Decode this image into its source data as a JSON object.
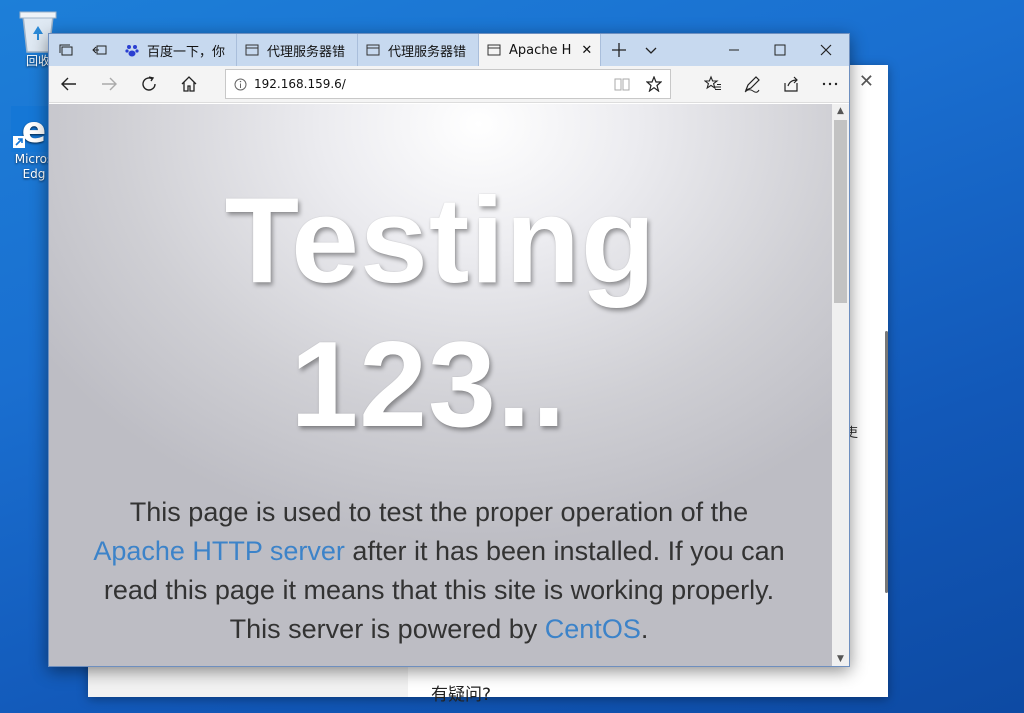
{
  "desktop": {
    "icons": [
      {
        "label": "回收",
        "icon": "recycle-bin-icon"
      },
      {
        "label": "Micros Edg",
        "icon": "edge-icon"
      }
    ]
  },
  "background_window": {
    "text_glyph": "吏",
    "question": "有疑问?"
  },
  "browser": {
    "tabs": [
      {
        "title": "百度一下，你",
        "icon": "baidu-paw-icon",
        "active": false
      },
      {
        "title": "代理服务器错",
        "icon": "page-icon",
        "active": false
      },
      {
        "title": "代理服务器错",
        "icon": "page-icon",
        "active": false
      },
      {
        "title": "Apache H",
        "icon": "page-icon",
        "active": true
      }
    ],
    "address": "192.168.159.6/"
  },
  "page": {
    "heading_line1": "Testing",
    "heading_line2": "123..",
    "lead_part1": "This page is used to test the proper operation of the ",
    "link_apache": "Apache HTTP server",
    "lead_part2": " after it has been installed. If you can read this page it means that this site is working properly. This server is powered by ",
    "link_centos": "CentOS",
    "lead_part3": "."
  },
  "colors": {
    "link": "#3c83c9",
    "titlebar": "#c7d9ef",
    "desktop": "#1a6fd0"
  }
}
